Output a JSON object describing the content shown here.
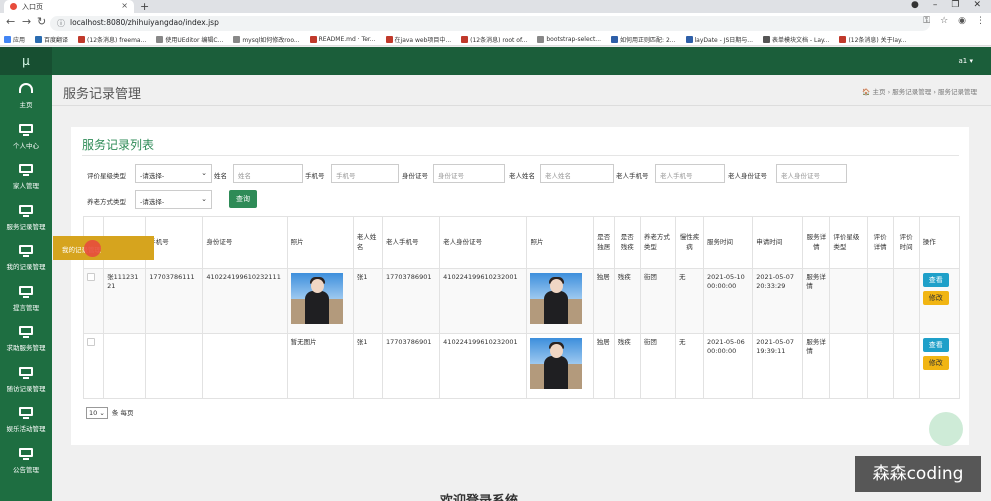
{
  "browser": {
    "tab_title": "入口页",
    "url": "localhost:8080/zhihuiyangdao/index.jsp",
    "window_controls": [
      "●",
      "–",
      "❐",
      "✕"
    ],
    "bookmarks": [
      {
        "label": "应用",
        "color": "#4285f4"
      },
      {
        "label": "百度翻译",
        "color": "#2b6cb0"
      },
      {
        "label": "(12条消息) freema...",
        "color": "#c0392b"
      },
      {
        "label": "使用UEditor 编辑C...",
        "color": "#888888"
      },
      {
        "label": "mysql如何修改roo...",
        "color": "#888888"
      },
      {
        "label": "README.md · Ter...",
        "color": "#c0392b"
      },
      {
        "label": "在java web项目中...",
        "color": "#c0392b"
      },
      {
        "label": "(12条消息) root of...",
        "color": "#c0392b"
      },
      {
        "label": "bootstrap-select...",
        "color": "#888888"
      },
      {
        "label": "如何用正则匹配: 2...",
        "color": "#2e5fa8"
      },
      {
        "label": "layDate - JS日期与...",
        "color": "#2e5fa8"
      },
      {
        "label": "表单模块文档 - Lay...",
        "color": "#555555"
      },
      {
        "label": "(12条消息) 关于lay...",
        "color": "#c0392b"
      }
    ]
  },
  "app": {
    "logo": "μ",
    "user": "a1 ▾",
    "sidebar": [
      {
        "label": "主页",
        "icon": "dashboard-icon"
      },
      {
        "label": "个人中心",
        "icon": "monitor-icon"
      },
      {
        "label": "家人管理",
        "icon": "monitor-icon"
      },
      {
        "label": "服务记录管理",
        "icon": "monitor-icon"
      },
      {
        "label": "我的记录管理",
        "icon": "monitor-icon"
      },
      {
        "label": "提言管理",
        "icon": "monitor-icon"
      },
      {
        "label": "求助服务管理",
        "icon": "monitor-icon"
      },
      {
        "label": "随访记录管理",
        "icon": "monitor-icon"
      },
      {
        "label": "娱乐活动管理",
        "icon": "monitor-icon"
      },
      {
        "label": "公告管理",
        "icon": "monitor-icon"
      }
    ]
  },
  "page": {
    "title": "服务记录管理",
    "breadcrumb": "🏠 主页 › 服务记录管理 › 服务记录管理",
    "panel_title": "服务记录列表"
  },
  "filters": {
    "rating_type_label": "评价星级类型",
    "rating_type_value": "-请选择-",
    "name_label": "姓名",
    "name_placeholder": "姓名",
    "phone_label": "手机号",
    "phone_placeholder": "手机号",
    "idcard_label": "身份证号",
    "idcard_placeholder": "身份证号",
    "elder_name_label": "老人姓名",
    "elder_name_placeholder": "老人姓名",
    "elder_phone_label": "老人手机号",
    "elder_phone_placeholder": "老人手机号",
    "elder_idcard_label": "老人身份证号",
    "elder_idcard_placeholder": "老人身份证号",
    "care_type_label": "养老方式类型",
    "care_type_value": "-请选择-",
    "query_button": "查询"
  },
  "table": {
    "columns": [
      "",
      "",
      "手机号",
      "身份证号",
      "照片",
      "老人姓名",
      "老人手机号",
      "老人身份证号",
      "照片",
      "是否独居",
      "是否残疾",
      "养老方式类型",
      "慢性疾病",
      "服务时间",
      "申请时间",
      "服务详情",
      "评价星级类型",
      "评价详情",
      "评价时间",
      "操作"
    ],
    "rows": [
      {
        "name": "张11123121",
        "phone": "17703786111",
        "idcard": "410224199610232111",
        "photo": "photo",
        "elder_name": "张1",
        "elder_phone": "17703786901",
        "elder_idcard": "410224199610232001",
        "elder_photo": "photo",
        "alone": "独居",
        "disabled": "残疾",
        "care_type": "街团",
        "chronic": "无",
        "service_time": "2021-05-10 00:00:00",
        "apply_time": "2021-05-07 20:33:29",
        "service_detail": "服务详情",
        "rating_type": "",
        "rating_detail": "",
        "rating_time": ""
      },
      {
        "name": "",
        "phone": "",
        "idcard": "",
        "photo": "暂无图片",
        "elder_name": "张1",
        "elder_phone": "17703786901",
        "elder_idcard": "410224199610232001",
        "elder_photo": "photo",
        "alone": "独居",
        "disabled": "残疾",
        "care_type": "街团",
        "chronic": "无",
        "service_time": "2021-05-06 00:00:00",
        "apply_time": "2021-05-07 19:39:11",
        "service_detail": "服务详情",
        "rating_type": "",
        "rating_detail": "",
        "rating_time": ""
      }
    ],
    "view_button": "查看",
    "edit_button": "修改"
  },
  "pager": {
    "page_size": "10",
    "suffix": "条 每页"
  },
  "overlay": {
    "tooltip": "我的记录管理",
    "watermark": "森森coding",
    "bottom_text": "欢迎登录系统"
  }
}
